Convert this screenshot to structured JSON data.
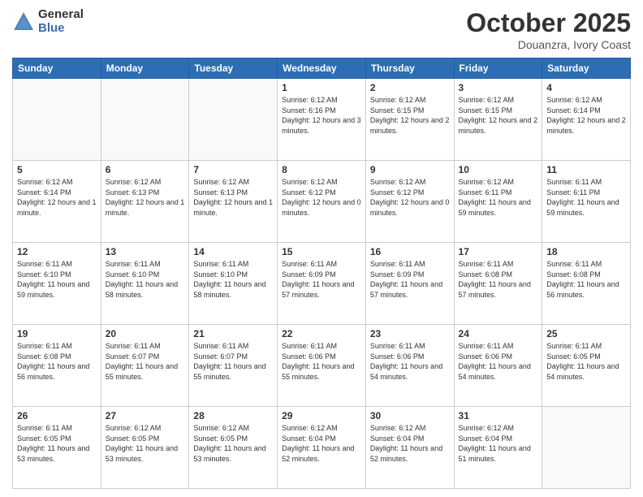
{
  "header": {
    "logo_general": "General",
    "logo_blue": "Blue",
    "month": "October 2025",
    "location": "Douanzra, Ivory Coast"
  },
  "weekdays": [
    "Sunday",
    "Monday",
    "Tuesday",
    "Wednesday",
    "Thursday",
    "Friday",
    "Saturday"
  ],
  "weeks": [
    [
      {
        "day": "",
        "info": ""
      },
      {
        "day": "",
        "info": ""
      },
      {
        "day": "",
        "info": ""
      },
      {
        "day": "1",
        "info": "Sunrise: 6:12 AM\nSunset: 6:16 PM\nDaylight: 12 hours and 3 minutes."
      },
      {
        "day": "2",
        "info": "Sunrise: 6:12 AM\nSunset: 6:15 PM\nDaylight: 12 hours and 2 minutes."
      },
      {
        "day": "3",
        "info": "Sunrise: 6:12 AM\nSunset: 6:15 PM\nDaylight: 12 hours and 2 minutes."
      },
      {
        "day": "4",
        "info": "Sunrise: 6:12 AM\nSunset: 6:14 PM\nDaylight: 12 hours and 2 minutes."
      }
    ],
    [
      {
        "day": "5",
        "info": "Sunrise: 6:12 AM\nSunset: 6:14 PM\nDaylight: 12 hours and 1 minute."
      },
      {
        "day": "6",
        "info": "Sunrise: 6:12 AM\nSunset: 6:13 PM\nDaylight: 12 hours and 1 minute."
      },
      {
        "day": "7",
        "info": "Sunrise: 6:12 AM\nSunset: 6:13 PM\nDaylight: 12 hours and 1 minute."
      },
      {
        "day": "8",
        "info": "Sunrise: 6:12 AM\nSunset: 6:12 PM\nDaylight: 12 hours and 0 minutes."
      },
      {
        "day": "9",
        "info": "Sunrise: 6:12 AM\nSunset: 6:12 PM\nDaylight: 12 hours and 0 minutes."
      },
      {
        "day": "10",
        "info": "Sunrise: 6:12 AM\nSunset: 6:11 PM\nDaylight: 11 hours and 59 minutes."
      },
      {
        "day": "11",
        "info": "Sunrise: 6:11 AM\nSunset: 6:11 PM\nDaylight: 11 hours and 59 minutes."
      }
    ],
    [
      {
        "day": "12",
        "info": "Sunrise: 6:11 AM\nSunset: 6:10 PM\nDaylight: 11 hours and 59 minutes."
      },
      {
        "day": "13",
        "info": "Sunrise: 6:11 AM\nSunset: 6:10 PM\nDaylight: 11 hours and 58 minutes."
      },
      {
        "day": "14",
        "info": "Sunrise: 6:11 AM\nSunset: 6:10 PM\nDaylight: 11 hours and 58 minutes."
      },
      {
        "day": "15",
        "info": "Sunrise: 6:11 AM\nSunset: 6:09 PM\nDaylight: 11 hours and 57 minutes."
      },
      {
        "day": "16",
        "info": "Sunrise: 6:11 AM\nSunset: 6:09 PM\nDaylight: 11 hours and 57 minutes."
      },
      {
        "day": "17",
        "info": "Sunrise: 6:11 AM\nSunset: 6:08 PM\nDaylight: 11 hours and 57 minutes."
      },
      {
        "day": "18",
        "info": "Sunrise: 6:11 AM\nSunset: 6:08 PM\nDaylight: 11 hours and 56 minutes."
      }
    ],
    [
      {
        "day": "19",
        "info": "Sunrise: 6:11 AM\nSunset: 6:08 PM\nDaylight: 11 hours and 56 minutes."
      },
      {
        "day": "20",
        "info": "Sunrise: 6:11 AM\nSunset: 6:07 PM\nDaylight: 11 hours and 55 minutes."
      },
      {
        "day": "21",
        "info": "Sunrise: 6:11 AM\nSunset: 6:07 PM\nDaylight: 11 hours and 55 minutes."
      },
      {
        "day": "22",
        "info": "Sunrise: 6:11 AM\nSunset: 6:06 PM\nDaylight: 11 hours and 55 minutes."
      },
      {
        "day": "23",
        "info": "Sunrise: 6:11 AM\nSunset: 6:06 PM\nDaylight: 11 hours and 54 minutes."
      },
      {
        "day": "24",
        "info": "Sunrise: 6:11 AM\nSunset: 6:06 PM\nDaylight: 11 hours and 54 minutes."
      },
      {
        "day": "25",
        "info": "Sunrise: 6:11 AM\nSunset: 6:05 PM\nDaylight: 11 hours and 54 minutes."
      }
    ],
    [
      {
        "day": "26",
        "info": "Sunrise: 6:11 AM\nSunset: 6:05 PM\nDaylight: 11 hours and 53 minutes."
      },
      {
        "day": "27",
        "info": "Sunrise: 6:12 AM\nSunset: 6:05 PM\nDaylight: 11 hours and 53 minutes."
      },
      {
        "day": "28",
        "info": "Sunrise: 6:12 AM\nSunset: 6:05 PM\nDaylight: 11 hours and 53 minutes."
      },
      {
        "day": "29",
        "info": "Sunrise: 6:12 AM\nSunset: 6:04 PM\nDaylight: 11 hours and 52 minutes."
      },
      {
        "day": "30",
        "info": "Sunrise: 6:12 AM\nSunset: 6:04 PM\nDaylight: 11 hours and 52 minutes."
      },
      {
        "day": "31",
        "info": "Sunrise: 6:12 AM\nSunset: 6:04 PM\nDaylight: 11 hours and 51 minutes."
      },
      {
        "day": "",
        "info": ""
      }
    ]
  ]
}
